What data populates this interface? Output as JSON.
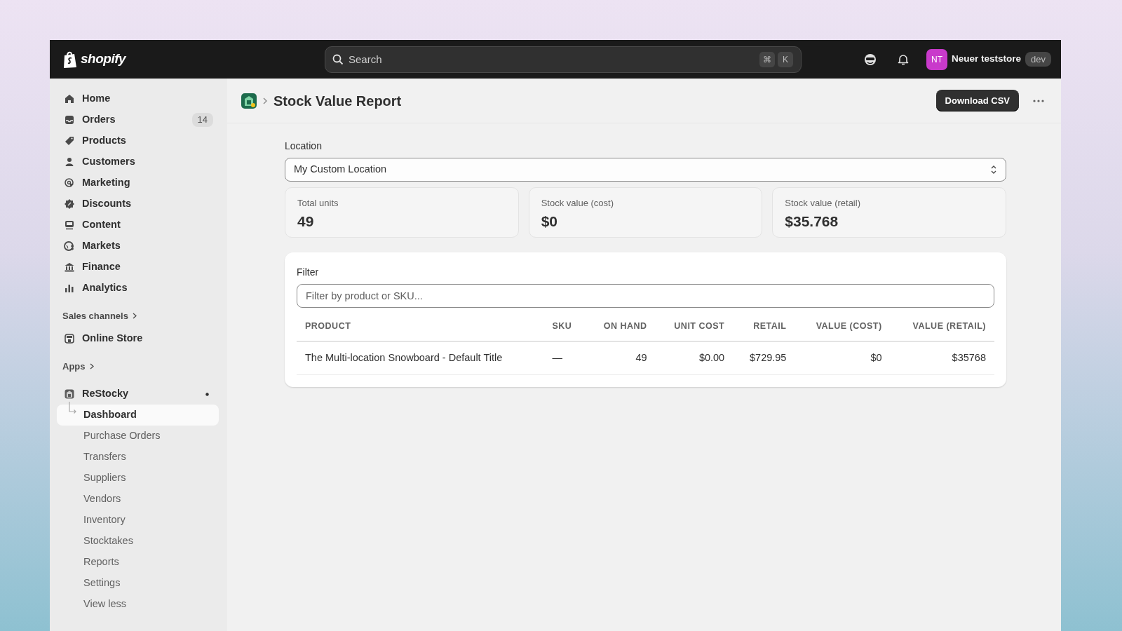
{
  "topbar": {
    "logo": "shopify",
    "search": {
      "placeholder": "Search",
      "keys": [
        "⌘",
        "K"
      ]
    },
    "store": {
      "initials": "NT",
      "name": "Neuer teststore",
      "tag": "dev"
    }
  },
  "sidebar": {
    "items": [
      {
        "label": "Home",
        "selected": false
      },
      {
        "label": "Orders",
        "badge": "14",
        "selected": false
      },
      {
        "label": "Products",
        "selected": false
      },
      {
        "label": "Customers",
        "selected": false
      },
      {
        "label": "Marketing",
        "selected": false
      },
      {
        "label": "Discounts",
        "selected": false
      },
      {
        "label": "Content",
        "selected": false
      },
      {
        "label": "Markets",
        "selected": false
      },
      {
        "label": "Finance",
        "selected": false
      },
      {
        "label": "Analytics",
        "selected": false
      }
    ],
    "sales_channels": {
      "heading": "Sales channels",
      "items": [
        {
          "label": "Online Store",
          "selected": false
        }
      ]
    },
    "apps": {
      "heading": "Apps",
      "app": {
        "label": "ReStocky",
        "unread": true,
        "children": [
          {
            "label": "Dashboard",
            "selected": true
          },
          {
            "label": "Purchase Orders",
            "selected": false
          },
          {
            "label": "Transfers",
            "selected": false
          },
          {
            "label": "Suppliers",
            "selected": false
          },
          {
            "label": "Vendors",
            "selected": false
          },
          {
            "label": "Inventory",
            "selected": false
          },
          {
            "label": "Stocktakes",
            "selected": false
          },
          {
            "label": "Reports",
            "selected": false
          },
          {
            "label": "Settings",
            "selected": false
          },
          {
            "label": "View less",
            "selected": false
          }
        ]
      }
    }
  },
  "page": {
    "title": "Stock Value Report",
    "primary_action": "Download CSV",
    "location": {
      "label": "Location",
      "value": "My Custom Location"
    },
    "stats": [
      {
        "label": "Total units",
        "value": "49"
      },
      {
        "label": "Stock value (cost)",
        "value": "$0"
      },
      {
        "label": "Stock value (retail)",
        "value": "$35.768"
      }
    ],
    "filter": {
      "label": "Filter",
      "placeholder": "Filter by product or SKU..."
    },
    "table": {
      "columns": [
        {
          "label": "PRODUCT",
          "kind": "text"
        },
        {
          "label": "SKU",
          "kind": "text"
        },
        {
          "label": "ON HAND",
          "kind": "number"
        },
        {
          "label": "UNIT COST",
          "kind": "number"
        },
        {
          "label": "RETAIL",
          "kind": "number"
        },
        {
          "label": "VALUE (COST)",
          "kind": "number"
        },
        {
          "label": "VALUE (RETAIL)",
          "kind": "number"
        }
      ],
      "rows": [
        [
          "The Multi-location Snowboard - Default Title",
          "—",
          "49",
          "$0.00",
          "$729.95",
          "$0",
          "$35768"
        ]
      ]
    }
  }
}
